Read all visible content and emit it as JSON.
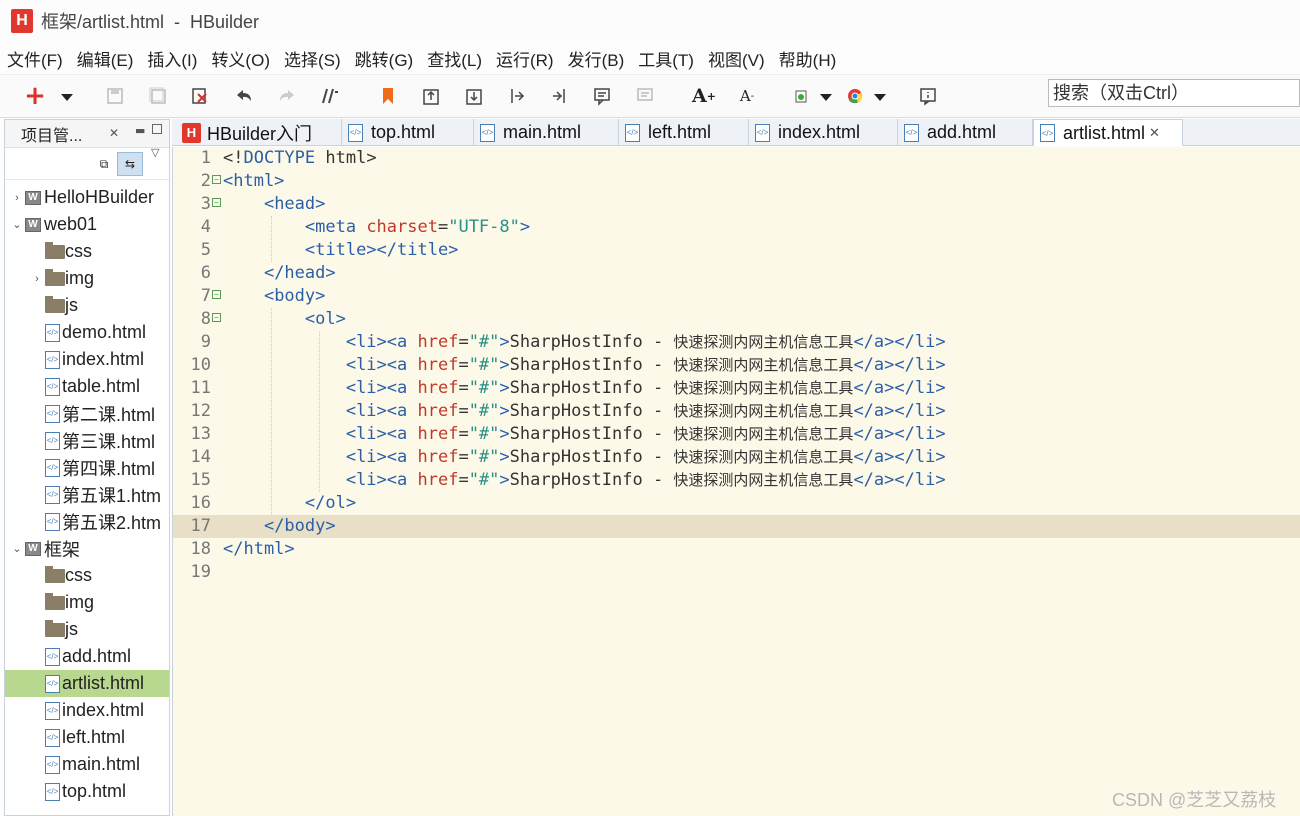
{
  "window": {
    "logo_letter": "H",
    "title": "框架/artlist.html  -  HBuilder"
  },
  "menu": [
    "文件(F)",
    "编辑(E)",
    "插入(I)",
    "转义(O)",
    "选择(S)",
    "跳转(G)",
    "查找(L)",
    "运行(R)",
    "发行(B)",
    "工具(T)",
    "视图(V)",
    "帮助(H)"
  ],
  "toolbar": {
    "buttons": [
      "new-file",
      "save",
      "save-all",
      "close",
      "undo",
      "redo",
      "format",
      "bookmark",
      "goto-prev",
      "goto-next",
      "jump-start",
      "jump-end",
      "comment",
      "uncomment",
      "font-increase",
      "font-decrease",
      "run-browser",
      "chrome",
      "preview"
    ],
    "search_placeholder": "搜索（双击Ctrl）"
  },
  "project_panel": {
    "title": "项目管...",
    "tree": [
      {
        "type": "project",
        "label": "HelloHBuilder",
        "twisty": "›",
        "depth": 0
      },
      {
        "type": "project",
        "label": "web01",
        "twisty": "⌄",
        "depth": 0
      },
      {
        "type": "folder",
        "label": "css",
        "depth": 1
      },
      {
        "type": "folder",
        "label": "img",
        "twisty": "›",
        "depth": 1
      },
      {
        "type": "folder",
        "label": "js",
        "depth": 1
      },
      {
        "type": "file",
        "label": "demo.html",
        "depth": 1
      },
      {
        "type": "file",
        "label": "index.html",
        "depth": 1
      },
      {
        "type": "file",
        "label": "table.html",
        "depth": 1
      },
      {
        "type": "file",
        "label": "第二课.html",
        "depth": 1
      },
      {
        "type": "file",
        "label": "第三课.html",
        "depth": 1
      },
      {
        "type": "file",
        "label": "第四课.html",
        "depth": 1
      },
      {
        "type": "file",
        "label": "第五课1.htm",
        "depth": 1
      },
      {
        "type": "file",
        "label": "第五课2.htm",
        "depth": 1
      },
      {
        "type": "project",
        "label": "框架",
        "twisty": "⌄",
        "depth": 0
      },
      {
        "type": "folder",
        "label": "css",
        "depth": 1
      },
      {
        "type": "folder",
        "label": "img",
        "depth": 1
      },
      {
        "type": "folder",
        "label": "js",
        "depth": 1
      },
      {
        "type": "file",
        "label": "add.html",
        "depth": 1
      },
      {
        "type": "file",
        "label": "artlist.html",
        "depth": 1,
        "selected": true
      },
      {
        "type": "file",
        "label": "index.html",
        "depth": 1
      },
      {
        "type": "file",
        "label": "left.html",
        "depth": 1
      },
      {
        "type": "file",
        "label": "main.html",
        "depth": 1
      },
      {
        "type": "file",
        "label": "top.html",
        "depth": 1
      }
    ]
  },
  "tabs": [
    {
      "label": "HBuilder入门",
      "kind": "hbuilder"
    },
    {
      "label": "top.html",
      "kind": "file"
    },
    {
      "label": "main.html",
      "kind": "file"
    },
    {
      "label": "left.html",
      "kind": "file"
    },
    {
      "label": "index.html",
      "kind": "file"
    },
    {
      "label": "add.html",
      "kind": "file"
    },
    {
      "label": "artlist.html",
      "kind": "file",
      "active": true,
      "close": "✕"
    }
  ],
  "editor": {
    "current_line": 17,
    "lines": [
      {
        "n": "1",
        "fold": "",
        "tokens": [
          [
            "plain",
            "<!"
          ],
          [
            "tag",
            "DOCTYPE"
          ],
          [
            "plain",
            " html>"
          ]
        ]
      },
      {
        "n": "2",
        "fold": "⊟",
        "tokens": [
          [
            "tag",
            "<html>"
          ]
        ]
      },
      {
        "n": "3",
        "fold": "⊟",
        "tokens": [
          [
            "plain",
            "    "
          ],
          [
            "tag",
            "<head>"
          ]
        ]
      },
      {
        "n": "4",
        "fold": "",
        "tokens": [
          [
            "plain",
            "        "
          ],
          [
            "tag",
            "<meta "
          ],
          [
            "attr",
            "charset"
          ],
          [
            "plain",
            "="
          ],
          [
            "str",
            "\"UTF-8\""
          ],
          [
            "tag",
            ">"
          ]
        ]
      },
      {
        "n": "5",
        "fold": "",
        "tokens": [
          [
            "plain",
            "        "
          ],
          [
            "tag",
            "<title></title>"
          ]
        ]
      },
      {
        "n": "6",
        "fold": "",
        "tokens": [
          [
            "plain",
            "    "
          ],
          [
            "tag",
            "</head>"
          ]
        ]
      },
      {
        "n": "7",
        "fold": "⊟",
        "tokens": [
          [
            "plain",
            "    "
          ],
          [
            "tag",
            "<body>"
          ]
        ]
      },
      {
        "n": "8",
        "fold": "⊟",
        "tokens": [
          [
            "plain",
            "        "
          ],
          [
            "tag",
            "<ol>"
          ]
        ]
      },
      {
        "n": "9",
        "fold": "",
        "tokens": [
          [
            "plain",
            "            "
          ],
          [
            "tag",
            "<li><a "
          ],
          [
            "attr",
            "href"
          ],
          [
            "plain",
            "="
          ],
          [
            "str",
            "\"#\""
          ],
          [
            "tag",
            ">"
          ],
          [
            "plain",
            "SharpHostInfo - "
          ],
          [
            "cjk",
            "快速探测内网主机信息工具"
          ],
          [
            "tag",
            "</a></li>"
          ]
        ]
      },
      {
        "n": "10",
        "fold": "",
        "tokens": [
          [
            "plain",
            "            "
          ],
          [
            "tag",
            "<li><a "
          ],
          [
            "attr",
            "href"
          ],
          [
            "plain",
            "="
          ],
          [
            "str",
            "\"#\""
          ],
          [
            "tag",
            ">"
          ],
          [
            "plain",
            "SharpHostInfo - "
          ],
          [
            "cjk",
            "快速探测内网主机信息工具"
          ],
          [
            "tag",
            "</a></li>"
          ]
        ]
      },
      {
        "n": "11",
        "fold": "",
        "tokens": [
          [
            "plain",
            "            "
          ],
          [
            "tag",
            "<li><a "
          ],
          [
            "attr",
            "href"
          ],
          [
            "plain",
            "="
          ],
          [
            "str",
            "\"#\""
          ],
          [
            "tag",
            ">"
          ],
          [
            "plain",
            "SharpHostInfo - "
          ],
          [
            "cjk",
            "快速探测内网主机信息工具"
          ],
          [
            "tag",
            "</a></li>"
          ]
        ]
      },
      {
        "n": "12",
        "fold": "",
        "tokens": [
          [
            "plain",
            "            "
          ],
          [
            "tag",
            "<li><a "
          ],
          [
            "attr",
            "href"
          ],
          [
            "plain",
            "="
          ],
          [
            "str",
            "\"#\""
          ],
          [
            "tag",
            ">"
          ],
          [
            "plain",
            "SharpHostInfo - "
          ],
          [
            "cjk",
            "快速探测内网主机信息工具"
          ],
          [
            "tag",
            "</a></li>"
          ]
        ]
      },
      {
        "n": "13",
        "fold": "",
        "tokens": [
          [
            "plain",
            "            "
          ],
          [
            "tag",
            "<li><a "
          ],
          [
            "attr",
            "href"
          ],
          [
            "plain",
            "="
          ],
          [
            "str",
            "\"#\""
          ],
          [
            "tag",
            ">"
          ],
          [
            "plain",
            "SharpHostInfo - "
          ],
          [
            "cjk",
            "快速探测内网主机信息工具"
          ],
          [
            "tag",
            "</a></li>"
          ]
        ]
      },
      {
        "n": "14",
        "fold": "",
        "tokens": [
          [
            "plain",
            "            "
          ],
          [
            "tag",
            "<li><a "
          ],
          [
            "attr",
            "href"
          ],
          [
            "plain",
            "="
          ],
          [
            "str",
            "\"#\""
          ],
          [
            "tag",
            ">"
          ],
          [
            "plain",
            "SharpHostInfo - "
          ],
          [
            "cjk",
            "快速探测内网主机信息工具"
          ],
          [
            "tag",
            "</a></li>"
          ]
        ]
      },
      {
        "n": "15",
        "fold": "",
        "tokens": [
          [
            "plain",
            "            "
          ],
          [
            "tag",
            "<li><a "
          ],
          [
            "attr",
            "href"
          ],
          [
            "plain",
            "="
          ],
          [
            "str",
            "\"#\""
          ],
          [
            "tag",
            ">"
          ],
          [
            "plain",
            "SharpHostInfo - "
          ],
          [
            "cjk",
            "快速探测内网主机信息工具"
          ],
          [
            "tag",
            "</a></li>"
          ]
        ]
      },
      {
        "n": "16",
        "fold": "",
        "tokens": [
          [
            "plain",
            "        "
          ],
          [
            "tag",
            "</ol>"
          ]
        ]
      },
      {
        "n": "17",
        "fold": "",
        "tokens": [
          [
            "plain",
            "    "
          ],
          [
            "tag",
            "</body>"
          ]
        ]
      },
      {
        "n": "18",
        "fold": "",
        "tokens": [
          [
            "tag",
            "</html>"
          ]
        ]
      },
      {
        "n": "19",
        "fold": "",
        "tokens": []
      }
    ]
  },
  "watermark": "CSDN @芝芝又荔枝",
  "colors": {
    "editor_bg": "#fdf9e8",
    "current_line_bg": "#e8dfc6",
    "selected_tree_bg": "#b8d78f",
    "tag": "#2a5fa8",
    "attr": "#c0392b",
    "string": "#2a8f88",
    "logo_red": "#e0382e"
  }
}
